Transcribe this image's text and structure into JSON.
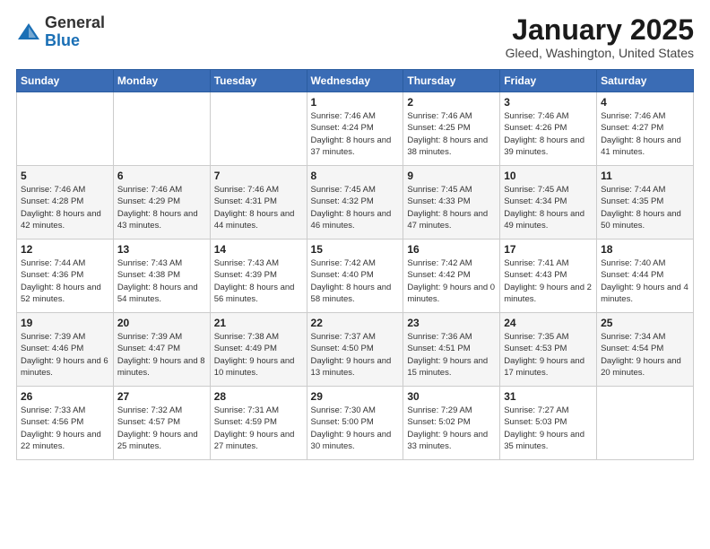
{
  "logo": {
    "general": "General",
    "blue": "Blue"
  },
  "header": {
    "month": "January 2025",
    "location": "Gleed, Washington, United States"
  },
  "days_of_week": [
    "Sunday",
    "Monday",
    "Tuesday",
    "Wednesday",
    "Thursday",
    "Friday",
    "Saturday"
  ],
  "weeks": [
    [
      {
        "day": "",
        "info": ""
      },
      {
        "day": "",
        "info": ""
      },
      {
        "day": "",
        "info": ""
      },
      {
        "day": "1",
        "info": "Sunrise: 7:46 AM\nSunset: 4:24 PM\nDaylight: 8 hours and 37 minutes."
      },
      {
        "day": "2",
        "info": "Sunrise: 7:46 AM\nSunset: 4:25 PM\nDaylight: 8 hours and 38 minutes."
      },
      {
        "day": "3",
        "info": "Sunrise: 7:46 AM\nSunset: 4:26 PM\nDaylight: 8 hours and 39 minutes."
      },
      {
        "day": "4",
        "info": "Sunrise: 7:46 AM\nSunset: 4:27 PM\nDaylight: 8 hours and 41 minutes."
      }
    ],
    [
      {
        "day": "5",
        "info": "Sunrise: 7:46 AM\nSunset: 4:28 PM\nDaylight: 8 hours and 42 minutes."
      },
      {
        "day": "6",
        "info": "Sunrise: 7:46 AM\nSunset: 4:29 PM\nDaylight: 8 hours and 43 minutes."
      },
      {
        "day": "7",
        "info": "Sunrise: 7:46 AM\nSunset: 4:31 PM\nDaylight: 8 hours and 44 minutes."
      },
      {
        "day": "8",
        "info": "Sunrise: 7:45 AM\nSunset: 4:32 PM\nDaylight: 8 hours and 46 minutes."
      },
      {
        "day": "9",
        "info": "Sunrise: 7:45 AM\nSunset: 4:33 PM\nDaylight: 8 hours and 47 minutes."
      },
      {
        "day": "10",
        "info": "Sunrise: 7:45 AM\nSunset: 4:34 PM\nDaylight: 8 hours and 49 minutes."
      },
      {
        "day": "11",
        "info": "Sunrise: 7:44 AM\nSunset: 4:35 PM\nDaylight: 8 hours and 50 minutes."
      }
    ],
    [
      {
        "day": "12",
        "info": "Sunrise: 7:44 AM\nSunset: 4:36 PM\nDaylight: 8 hours and 52 minutes."
      },
      {
        "day": "13",
        "info": "Sunrise: 7:43 AM\nSunset: 4:38 PM\nDaylight: 8 hours and 54 minutes."
      },
      {
        "day": "14",
        "info": "Sunrise: 7:43 AM\nSunset: 4:39 PM\nDaylight: 8 hours and 56 minutes."
      },
      {
        "day": "15",
        "info": "Sunrise: 7:42 AM\nSunset: 4:40 PM\nDaylight: 8 hours and 58 minutes."
      },
      {
        "day": "16",
        "info": "Sunrise: 7:42 AM\nSunset: 4:42 PM\nDaylight: 9 hours and 0 minutes."
      },
      {
        "day": "17",
        "info": "Sunrise: 7:41 AM\nSunset: 4:43 PM\nDaylight: 9 hours and 2 minutes."
      },
      {
        "day": "18",
        "info": "Sunrise: 7:40 AM\nSunset: 4:44 PM\nDaylight: 9 hours and 4 minutes."
      }
    ],
    [
      {
        "day": "19",
        "info": "Sunrise: 7:39 AM\nSunset: 4:46 PM\nDaylight: 9 hours and 6 minutes."
      },
      {
        "day": "20",
        "info": "Sunrise: 7:39 AM\nSunset: 4:47 PM\nDaylight: 9 hours and 8 minutes."
      },
      {
        "day": "21",
        "info": "Sunrise: 7:38 AM\nSunset: 4:49 PM\nDaylight: 9 hours and 10 minutes."
      },
      {
        "day": "22",
        "info": "Sunrise: 7:37 AM\nSunset: 4:50 PM\nDaylight: 9 hours and 13 minutes."
      },
      {
        "day": "23",
        "info": "Sunrise: 7:36 AM\nSunset: 4:51 PM\nDaylight: 9 hours and 15 minutes."
      },
      {
        "day": "24",
        "info": "Sunrise: 7:35 AM\nSunset: 4:53 PM\nDaylight: 9 hours and 17 minutes."
      },
      {
        "day": "25",
        "info": "Sunrise: 7:34 AM\nSunset: 4:54 PM\nDaylight: 9 hours and 20 minutes."
      }
    ],
    [
      {
        "day": "26",
        "info": "Sunrise: 7:33 AM\nSunset: 4:56 PM\nDaylight: 9 hours and 22 minutes."
      },
      {
        "day": "27",
        "info": "Sunrise: 7:32 AM\nSunset: 4:57 PM\nDaylight: 9 hours and 25 minutes."
      },
      {
        "day": "28",
        "info": "Sunrise: 7:31 AM\nSunset: 4:59 PM\nDaylight: 9 hours and 27 minutes."
      },
      {
        "day": "29",
        "info": "Sunrise: 7:30 AM\nSunset: 5:00 PM\nDaylight: 9 hours and 30 minutes."
      },
      {
        "day": "30",
        "info": "Sunrise: 7:29 AM\nSunset: 5:02 PM\nDaylight: 9 hours and 33 minutes."
      },
      {
        "day": "31",
        "info": "Sunrise: 7:27 AM\nSunset: 5:03 PM\nDaylight: 9 hours and 35 minutes."
      },
      {
        "day": "",
        "info": ""
      }
    ]
  ]
}
